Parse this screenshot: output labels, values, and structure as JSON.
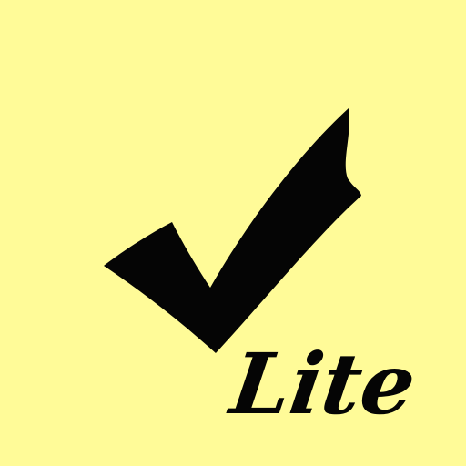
{
  "app_icon": {
    "background_color": "#fffb98",
    "foreground_color": "#050505",
    "badge_text": "Lite",
    "icon_name": "checkmark-icon"
  }
}
